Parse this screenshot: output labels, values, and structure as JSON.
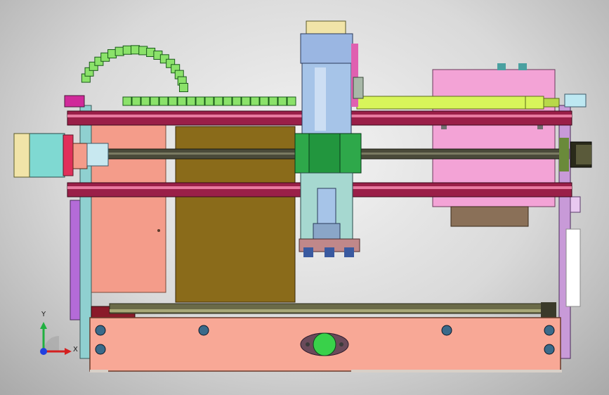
{
  "viewport": {
    "background_center": "#f4f4f4",
    "background_edge": "#a9a9a9"
  },
  "model_view": {
    "view": "top",
    "components": [
      "stepper-motor",
      "cable-chain",
      "spindle-motor",
      "spindle-clamp",
      "gantry-rail-upper",
      "gantry-rail-lower",
      "lead-screw",
      "base-plate",
      "control-box",
      "tool-holder"
    ]
  },
  "colors": {
    "stepper_body": "#7fd9d2",
    "stepper_face": "#f1e4a8",
    "stepper_accent": "#e0305a",
    "cable_chain": "#8be26a",
    "rail": "#9a1f48",
    "rail_highlight": "#e87aa0",
    "lead_screw": "#4a4a3a",
    "spindle": "#a6c4e8",
    "clamp": "#2ea84a",
    "salmon_panel": "#f49c8a",
    "olive_panel": "#8a6b1a",
    "pink_box": "#f3a3d6",
    "lime_bar": "#d8f55a",
    "frame_side": "#c89ad8",
    "base_plate": "#f8a896",
    "green_knob": "#39d14a"
  },
  "axis_triad": {
    "x_label": "X",
    "y_label": "Y",
    "x_color": "#d42020",
    "y_color": "#20b040",
    "z_color": "#2040e0"
  }
}
